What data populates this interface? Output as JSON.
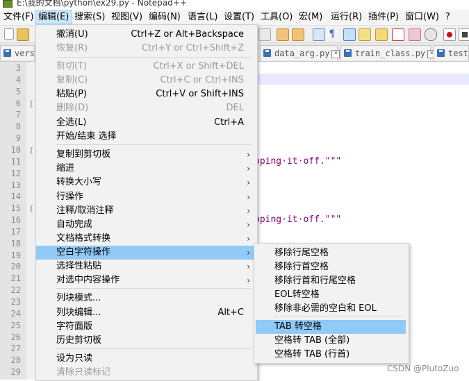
{
  "window": {
    "title": "E:\\我的文档\\python\\ex29.py - Notepad++"
  },
  "menubar": [
    {
      "label": "文件(F)"
    },
    {
      "label": "编辑(E)",
      "active": true
    },
    {
      "label": "搜索(S)"
    },
    {
      "label": "视图(V)"
    },
    {
      "label": "编码(N)"
    },
    {
      "label": "语言(L)"
    },
    {
      "label": "设置(T)"
    },
    {
      "label": "工具(O)"
    },
    {
      "label": "宏(M)"
    },
    {
      "label": "运行(R)"
    },
    {
      "label": "插件(P)"
    },
    {
      "label": "窗口(W)"
    },
    {
      "label": "?"
    }
  ],
  "tabs": [
    {
      "label": "vers"
    },
    {
      "label": "data_arg.py"
    },
    {
      "label": "train_class.py"
    },
    {
      "label": "test."
    }
  ],
  "editor": {
    "line_numbers": [
      "3",
      "4",
      "5",
      "6",
      "7",
      "8",
      "9",
      "10",
      "11",
      "12",
      "13",
      "14",
      "15",
      "16",
      "17",
      "18",
      "19",
      "20",
      "21",
      "22",
      "23",
      "24",
      "25",
      "26",
      "27",
      "28",
      "29"
    ],
    "visible_code": [
      {
        "text": "pping·it·off.\"\"\""
      },
      {
        "text": "pping·it·off.\"\"\""
      }
    ]
  },
  "edit_menu": [
    {
      "label": "撤消(U)",
      "shortcut": "Ctrl+Z or Alt+Backspace"
    },
    {
      "label": "恢复(R)",
      "shortcut": "Ctrl+Y or Ctrl+Shift+Z",
      "disabled": true
    },
    {
      "label": "剪切(T)",
      "shortcut": "Ctrl+X or Shift+DEL",
      "disabled": true
    },
    {
      "label": "复制(C)",
      "shortcut": "Ctrl+C or Ctrl+INS",
      "disabled": true
    },
    {
      "label": "粘贴(P)",
      "shortcut": "Ctrl+V or Shift+INS"
    },
    {
      "label": "删除(D)",
      "shortcut": "DEL",
      "disabled": true
    },
    {
      "label": "全选(L)",
      "shortcut": "Ctrl+A"
    },
    {
      "label": "开始/结束 选择",
      "shortcut": ""
    },
    {
      "label": "复制到剪切板",
      "submenu": true
    },
    {
      "label": "缩进",
      "submenu": true
    },
    {
      "label": "转换大小写",
      "submenu": true
    },
    {
      "label": "行操作",
      "submenu": true
    },
    {
      "label": "注释/取消注释",
      "submenu": true
    },
    {
      "label": "自动完成",
      "submenu": true
    },
    {
      "label": "文档格式转换",
      "submenu": true
    },
    {
      "label": "空白字符操作",
      "submenu": true,
      "highlighted": true
    },
    {
      "label": "选择性粘贴",
      "submenu": true
    },
    {
      "label": "对选中内容操作",
      "submenu": true
    },
    {
      "label": "列块模式...",
      "shortcut": ""
    },
    {
      "label": "列块编辑...",
      "shortcut": "Alt+C"
    },
    {
      "label": "字符面版",
      "shortcut": ""
    },
    {
      "label": "历史剪切板",
      "shortcut": ""
    },
    {
      "label": "设为只读",
      "shortcut": ""
    },
    {
      "label": "清除只读标记",
      "shortcut": "",
      "disabled": true
    }
  ],
  "whitespace_submenu": [
    {
      "label": "移除行尾空格"
    },
    {
      "label": "移除行首空格"
    },
    {
      "label": "移除行首和行尾空格"
    },
    {
      "label": "EOL转空格"
    },
    {
      "label": "移除非必需的空白和 EOL"
    },
    {
      "label": "TAB 转空格",
      "highlighted": true
    },
    {
      "label": "空格转 TAB (全部)"
    },
    {
      "label": "空格转 TAB (行首)"
    }
  ],
  "watermark": "CSDN @PlutoZuo",
  "colors": {
    "menu_highlight": "#91c9f7",
    "menubar_active": "#cce8ff",
    "string_text": "#7f007f",
    "current_line": "#e8e8ff"
  }
}
